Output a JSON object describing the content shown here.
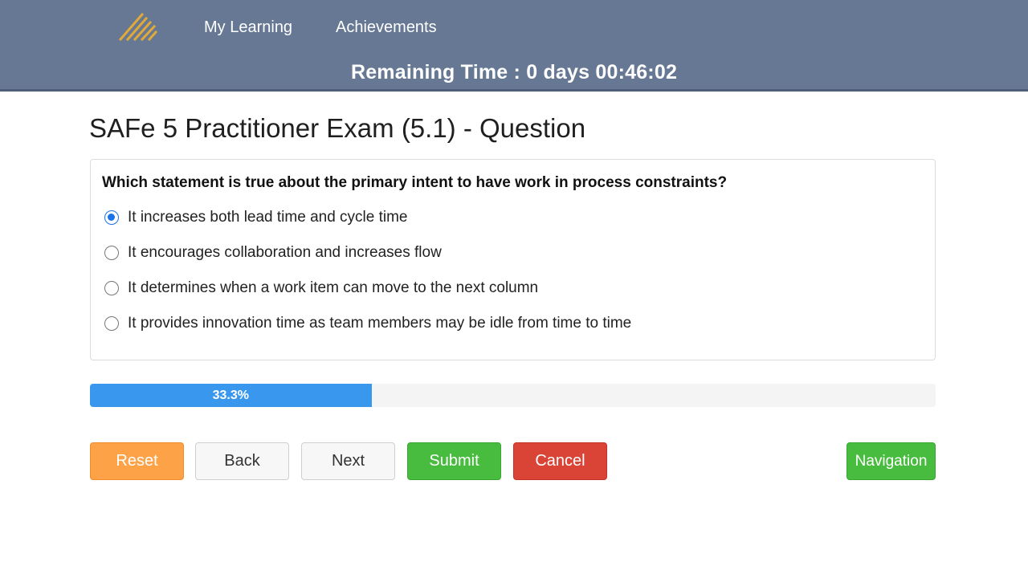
{
  "header": {
    "logo_icon": "striped-triangle-logo",
    "nav": [
      {
        "label": "My Learning"
      },
      {
        "label": "Achievements"
      }
    ],
    "timer_text": "Remaining Time : 0 days 00:46:02"
  },
  "exam": {
    "title": "SAFe 5 Practitioner Exam (5.1) - Question",
    "question": "Which statement is true about the primary intent to have work in process constraints?",
    "options": [
      {
        "label": "It increases both lead time and cycle time",
        "selected": true
      },
      {
        "label": "It encourages collaboration and increases flow",
        "selected": false
      },
      {
        "label": "It determines when a work item can move to the next column",
        "selected": false
      },
      {
        "label": "It provides innovation time as team members may be idle from time to time",
        "selected": false
      }
    ]
  },
  "progress": {
    "label": "33.3%",
    "value": 0.333
  },
  "buttons": {
    "reset": "Reset",
    "back": "Back",
    "next": "Next",
    "submit": "Submit",
    "cancel": "Cancel",
    "navigation": "Navigation"
  },
  "colors": {
    "header_bg": "#667893",
    "progress_fill": "#3a97ee",
    "reset": "#fda246",
    "submit": "#48bc3e",
    "cancel": "#d94437",
    "navigation": "#48bc3e",
    "logo": "#e0a93a"
  }
}
